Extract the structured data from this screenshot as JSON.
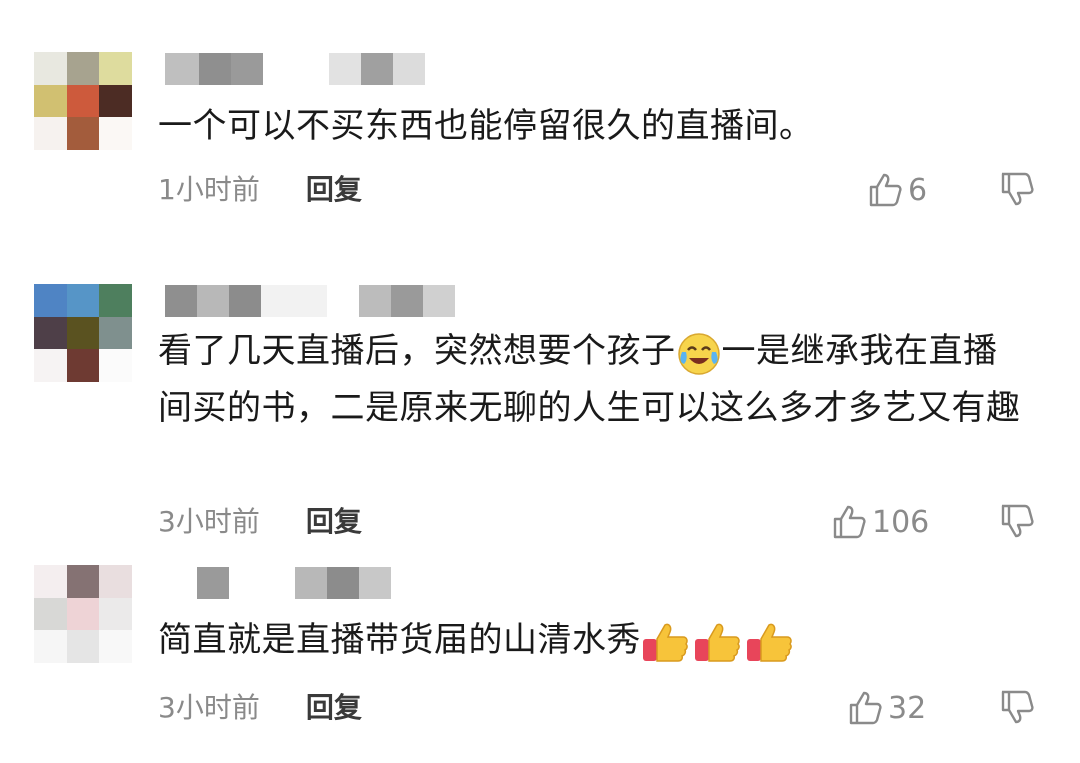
{
  "comments": [
    {
      "text": "一个可以不买东西也能停留很久的直播间。",
      "time": "1小时前",
      "reply_label": "回复",
      "likes": "6",
      "avatar_colors": [
        "#e8e8e0",
        "#a7a38f",
        "#dedc9e",
        "#d1c071",
        "#cd5a3c",
        "#4c2c24",
        "#f6f2ef",
        "#a35c3c",
        "#fbf8f5"
      ]
    },
    {
      "text_parts": [
        "看了几天直播后，突然想要个孩子",
        "一是继承我在直播间买的书，二是原来无聊的人生可以这么多才多艺又有趣"
      ],
      "emoji_1": "laughing-crying-emoji",
      "time": "3小时前",
      "reply_label": "回复",
      "likes": "106",
      "avatar_colors": [
        "#4f84c4",
        "#5695c7",
        "#4e7f5e",
        "#4e3f48",
        "#5a5220",
        "#7f908e",
        "#f6f3f3",
        "#6e3a32",
        "#fbfbfb"
      ]
    },
    {
      "text": "简直就是直播带货届的山清水秀",
      "emoji_2": "thumbs-up-emoji",
      "time": "3小时前",
      "reply_label": "回复",
      "likes": "32",
      "avatar_colors": [
        "#f4eeef",
        "#857273",
        "#e9dedf",
        "#d8d8d6",
        "#eed3d6",
        "#ebeaea",
        "#f6f6f6",
        "#e5e5e5",
        "#f8f8f8"
      ]
    }
  ]
}
